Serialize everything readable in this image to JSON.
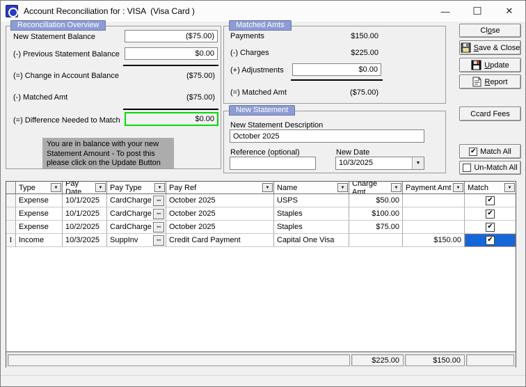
{
  "window": {
    "title": "Account Reconciliation for : VISA  (Visa Card )"
  },
  "icons": {
    "dropdown": "▼",
    "ellipsis": "···",
    "check": "✔",
    "ibeam": "I",
    "minimize": "—",
    "maximize": "☐",
    "close": "✕"
  },
  "colors": {
    "accent_tab": "#8D9CD3",
    "selection_blue": "#1566D8",
    "balance_ok_border": "#00DD00",
    "message_gray": "#ACACAC"
  },
  "overview": {
    "tab": "Reconciliation Overview",
    "new_statement_balance": {
      "label": "New Statement Balance",
      "value": "($75.00)"
    },
    "previous_statement_balance": {
      "label": "(-) Previous Statement Balance",
      "value": "$0.00"
    },
    "change_in_account_balance": {
      "label": "(=) Change in Account Balance",
      "value": "($75.00)"
    },
    "matched_amt": {
      "label": "(-) Matched Amt",
      "value": "($75.00)"
    },
    "difference_needed": {
      "label": "(=) Difference Needed to Match",
      "value": "$0.00"
    },
    "message": {
      "line1": "You are in balance with your new",
      "line2": "Statement Amount - To post this",
      "line3": "please click on the Update Button"
    }
  },
  "matched_amts": {
    "tab": "Matched Amts",
    "payments": {
      "label": "Payments",
      "value": "$150.00"
    },
    "charges": {
      "label": "(-) Charges",
      "value": "$225.00"
    },
    "adjustments": {
      "label": "(+) Adjustments",
      "value": "$0.00"
    },
    "matched_amt": {
      "label": "(=) Matched Amt",
      "value": "($75.00)"
    }
  },
  "new_statement": {
    "tab": "New Statement",
    "description_label": "New Statement Description",
    "description_value": "October 2025",
    "reference_label": "Reference (optional)",
    "reference_value": "",
    "date_label": "New Date",
    "date_value": "10/3/2025"
  },
  "buttons": {
    "close": {
      "pre": "Cl",
      "key": "o",
      "post": "se"
    },
    "save_close": {
      "pre": "",
      "key": "S",
      "post": "ave & Close"
    },
    "update": {
      "pre": "",
      "key": "U",
      "post": "pdate"
    },
    "report": {
      "pre": "",
      "key": "R",
      "post": "eport"
    },
    "ccard_fees": {
      "label": "Ccard Fees"
    },
    "match_all": {
      "label": "Match All"
    },
    "unmatch_all": {
      "label": "Un-Match All"
    }
  },
  "grid": {
    "headers": {
      "type": "Type",
      "pay_date": "Pay Date",
      "pay_type": "Pay Type",
      "pay_ref": "Pay Ref",
      "name": "Name",
      "charge_amt": "Charge Amt",
      "payment_amt": "Payment Amt",
      "match": "Match"
    },
    "rows": [
      {
        "type": "Expense",
        "pay_date": "10/1/2025",
        "pay_type": "CardCharge",
        "pay_ref": "October 2025",
        "name": "USPS",
        "charge_amt": "$50.00",
        "payment_amt": "",
        "match_checked": true
      },
      {
        "type": "Expense",
        "pay_date": "10/1/2025",
        "pay_type": "CardCharge",
        "pay_ref": "October 2025",
        "name": "Staples",
        "charge_amt": "$100.00",
        "payment_amt": "",
        "match_checked": true
      },
      {
        "type": "Expense",
        "pay_date": "10/2/2025",
        "pay_type": "CardCharge",
        "pay_ref": "October 2025",
        "name": "Staples",
        "charge_amt": "$75.00",
        "payment_amt": "",
        "match_checked": true
      },
      {
        "type": "Income",
        "pay_date": "10/3/2025",
        "pay_type": "SuppInv",
        "pay_ref": "Credit Card Payment",
        "name": "Capital One Visa",
        "charge_amt": "",
        "payment_amt": "$150.00",
        "match_checked": true,
        "selected": true
      }
    ],
    "totals": {
      "charge_amt": "$225.00",
      "payment_amt": "$150.00"
    }
  }
}
